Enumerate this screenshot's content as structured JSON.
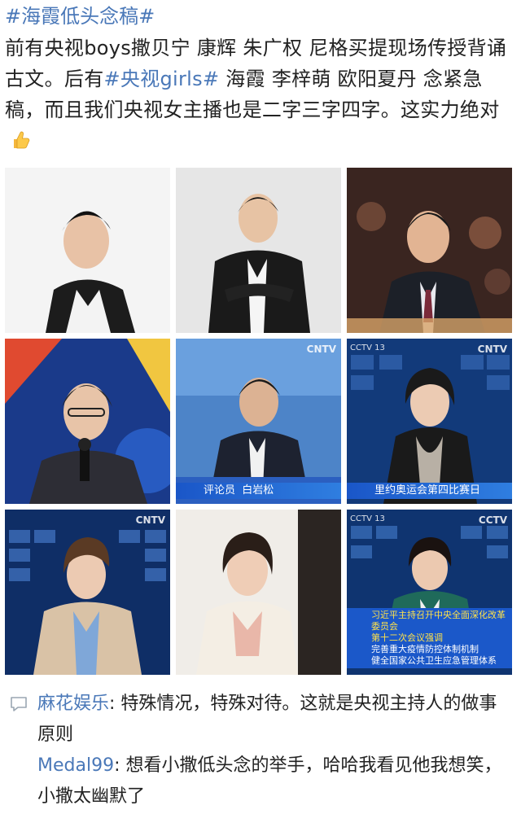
{
  "post": {
    "hashtag_title": "#海霞低头念稿#",
    "body_part1": "前有央视boys撒贝宁 康辉 朱广权 尼格买提现场传授背诵古文。后有",
    "body_tag": "#央视girls#",
    "body_part2": " 海霞 李梓萌 欧阳夏丹 念紧急稿，而且我们央视女主播也是二字三字四字。这实力绝对",
    "thumb_icon": "thumbs-up-emoji"
  },
  "grid": {
    "cells": [
      {
        "caption": ""
      },
      {
        "caption": ""
      },
      {
        "caption": ""
      },
      {
        "caption": ""
      },
      {
        "logo": "CNTV",
        "caption": "白岩松",
        "caption_prefix": "评论员"
      },
      {
        "logo": "CNTV",
        "channel": "CCTV 13",
        "caption": "里约奥运会第四比赛日"
      },
      {
        "logo": "CNTV",
        "caption": ""
      },
      {
        "caption": ""
      },
      {
        "logo": "CCTV",
        "channel": "CCTV 13",
        "ticker_yellow": "习近平主持召开中央全面深化改革委员会",
        "ticker_line2": "第十二次会议强调",
        "ticker_line3": "完善重大疫情防控体制机制",
        "ticker_line4": "健全国家公共卫生应急管理体系"
      }
    ]
  },
  "comments": [
    {
      "user": "麻花娱乐",
      "text": ": 特殊情况，特殊对待。这就是央视主持人的做事原则"
    },
    {
      "user": "Medal99",
      "text": ": 想看小撒低头念的举手，哈哈我看见他我想笑，小撒太幽默了"
    }
  ],
  "colors": {
    "link": "#4a78b8",
    "text": "#222222",
    "news_blue": "#1b58c9"
  }
}
